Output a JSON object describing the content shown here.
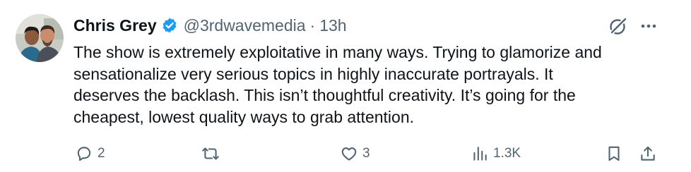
{
  "tweet": {
    "author_name": "Chris Grey",
    "handle": "@3rdwavemedia",
    "separator": "·",
    "time": "13h",
    "text_lines": [
      "The show is extremely exploitative in many ways. Trying to glamorize and",
      "sensationalize very serious topics in highly inaccurate portrayals. It",
      "deserves the backlash. This isn’t thoughtful creativity. It’s going for the",
      "cheapest, lowest quality ways to grab attention."
    ]
  },
  "actions": {
    "reply_count": "2",
    "retweet_count": "",
    "like_count": "3",
    "views_count": "1.3K"
  },
  "icons": {
    "verified": "verified-badge-icon",
    "grok": "grok-icon",
    "more": "more-icon",
    "reply": "reply-icon",
    "retweet": "retweet-icon",
    "like": "heart-icon",
    "views": "views-icon",
    "bookmark": "bookmark-icon",
    "share": "share-icon"
  },
  "colors": {
    "text": "#0f1419",
    "secondary": "#536471",
    "verified": "#1d9bf0"
  }
}
